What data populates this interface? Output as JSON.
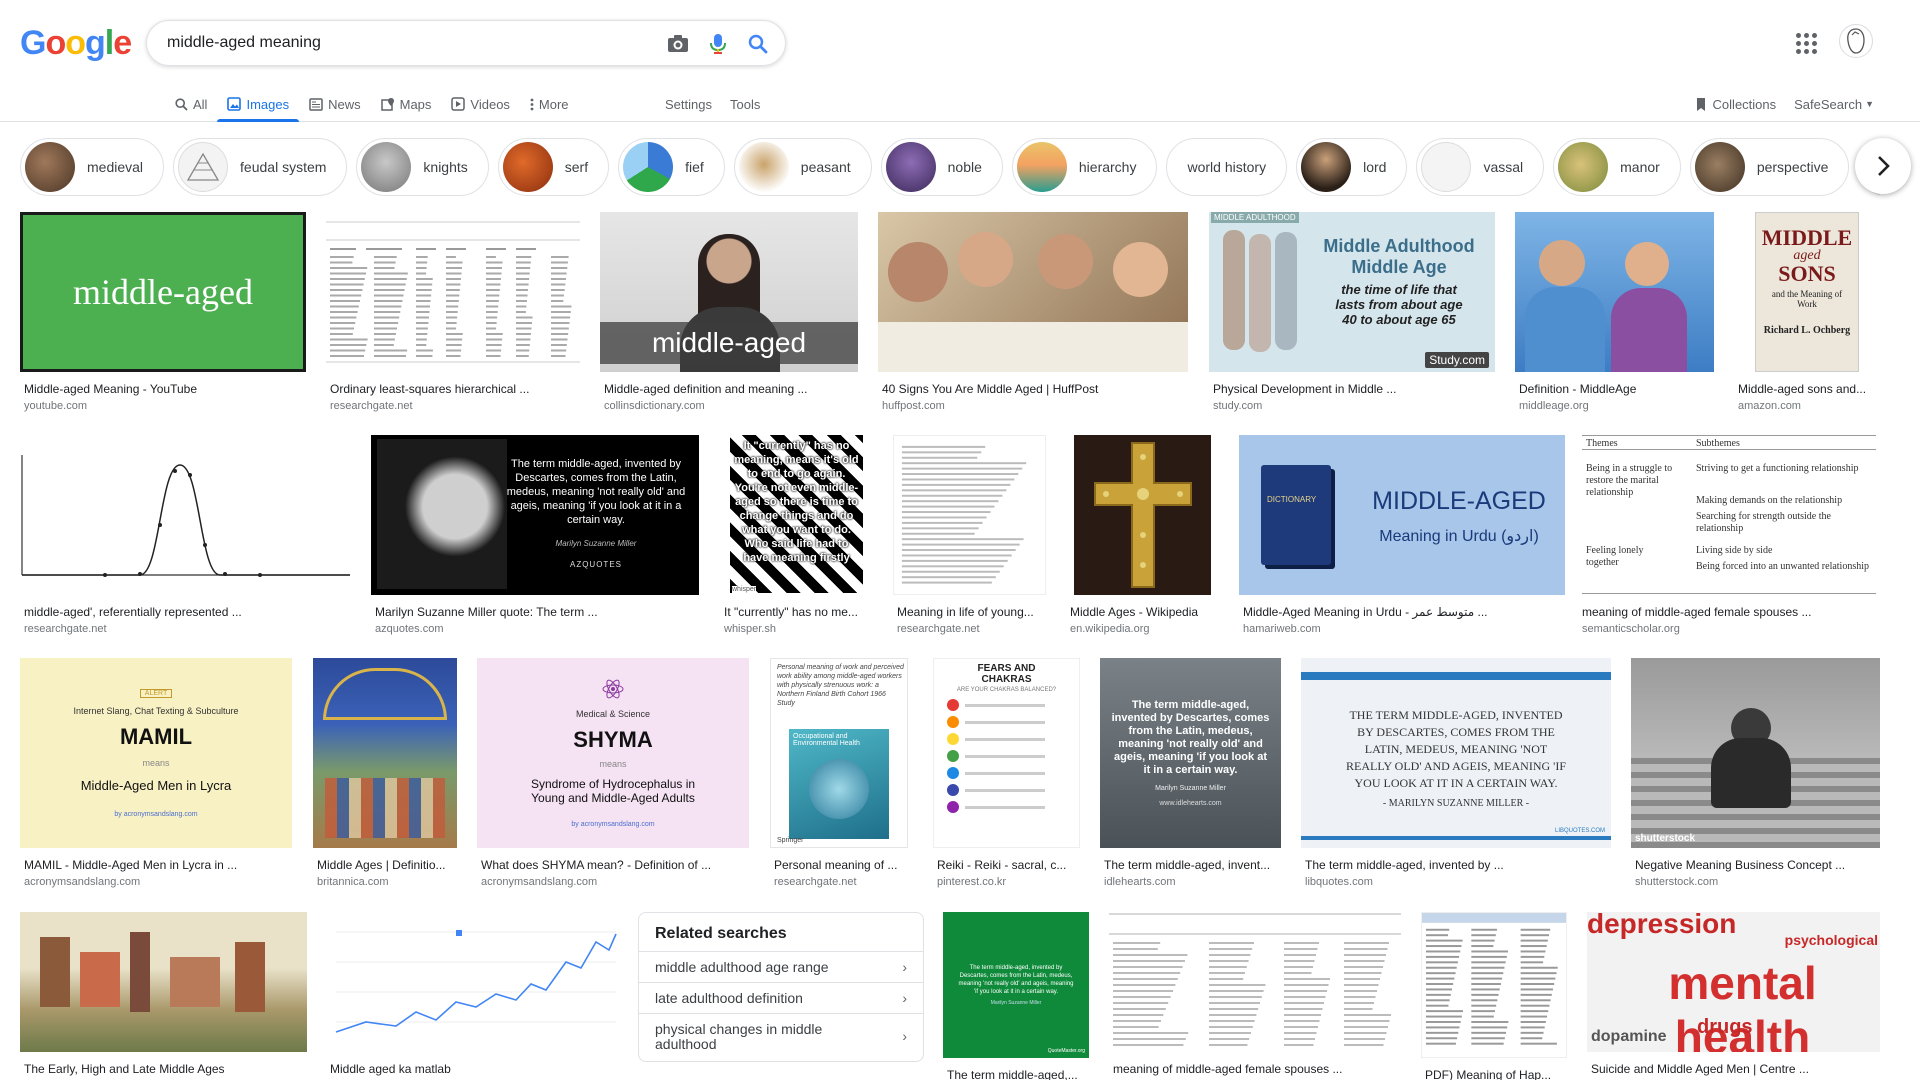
{
  "logo": "Google",
  "colors": {
    "blue": "#4285f4",
    "red": "#ea4335",
    "yellow": "#fbbc05",
    "green": "#34a853",
    "accent": "#1a73e8"
  },
  "search": {
    "query": "middle-aged meaning"
  },
  "tabs": [
    {
      "label": "All",
      "icon": "search-icon"
    },
    {
      "label": "Images",
      "icon": "image-icon"
    },
    {
      "label": "News",
      "icon": "news-icon"
    },
    {
      "label": "Maps",
      "icon": "map-icon"
    },
    {
      "label": "Videos",
      "icon": "video-icon"
    },
    {
      "label": "More",
      "icon": "more-vert-icon"
    }
  ],
  "tools": {
    "settings": "Settings",
    "tools": "Tools"
  },
  "right": {
    "collections": "Collections",
    "safesearch": "SafeSearch"
  },
  "chips": [
    "medieval",
    "feudal system",
    "knights",
    "serf",
    "fief",
    "peasant",
    "noble",
    "hierarchy",
    "world history",
    "lord",
    "vassal",
    "manor",
    "perspective"
  ],
  "results": [
    {
      "caption": "Middle-aged Meaning - YouTube",
      "source": "youtube.com",
      "text": "middle-aged"
    },
    {
      "caption": "Ordinary least-squares hierarchical ...",
      "source": "researchgate.net"
    },
    {
      "caption": "Middle-aged definition and meaning ...",
      "source": "collinsdictionary.com",
      "text": "middle-aged"
    },
    {
      "caption": "40 Signs You Are Middle Aged | HuffPost",
      "source": "huffpost.com"
    },
    {
      "caption": "Physical Development in Middle ...",
      "source": "study.com",
      "text": "Middle Adulthood",
      "text2": "Middle Age",
      "text3": "the time of life that lasts from about age 40 to about age 65",
      "text4": "Study.com",
      "text5": "MIDDLE ADULTHOOD"
    },
    {
      "caption": "Definition - MiddleAge",
      "source": "middleage.org"
    },
    {
      "caption": "Middle-aged sons and...",
      "source": "amazon.com",
      "text": "MIDDLE",
      "text2": "aged",
      "text3": "SONS",
      "text4": "and the Meaning of Work",
      "text5": "Richard L. Ochberg"
    },
    {
      "caption": "middle-aged', referentially represented ...",
      "source": "researchgate.net"
    },
    {
      "caption": "Marilyn Suzanne Miller quote: The term ...",
      "source": "azquotes.com",
      "text": "The term middle-aged, invented by Descartes, comes from the Latin, medeus, meaning 'not really old' and ageis, meaning 'if you look at it in a certain way.",
      "text2": "Marilyn Suzanne Miller",
      "text3": "AZQUOTES"
    },
    {
      "caption": "It \"currently\" has no me...",
      "source": "whisper.sh",
      "text": "It \"currently\" has no meaning, means it's old to end to go again. You're not even middle-aged so there is time to change things and do what you want to do. Who said life had to have meaning firstly",
      "text2": "whisper"
    },
    {
      "caption": "Meaning in life of young...",
      "source": "researchgate.net"
    },
    {
      "caption": "Middle Ages - Wikipedia",
      "source": "en.wikipedia.org"
    },
    {
      "caption": "Middle-Aged Meaning in Urdu - متوسط عمر ...",
      "source": "hamariweb.com",
      "text": "MIDDLE-AGED",
      "text2": "Meaning in Urdu (اردو)",
      "text3": "DICTIONARY"
    },
    {
      "caption": "meaning of middle-aged female spouses ...",
      "source": "semanticscholar.org",
      "text": "Themes",
      "text2": "Subthemes",
      "text3": "Being in a struggle to restore the marital relationship",
      "text4": "Striving to get a functioning relationship",
      "text5": "Making demands on the relationship",
      "text6": "Searching for strength outside the relationship",
      "text7": "Feeling lonely together",
      "text8": "Living side by side",
      "text9": "Being forced into an unwanted relationship"
    },
    {
      "caption": "MAMIL - Middle-Aged Men in Lycra in ...",
      "source": "acronymsandslang.com",
      "text": "Internet Slang, Chat Texting & Subculture",
      "text2": "MAMIL",
      "text3": "means",
      "text4": "Middle-Aged Men in Lycra",
      "text5": "ALERT",
      "text6": "by acronymsandslang.com"
    },
    {
      "caption": "Middle Ages | Definitio...",
      "source": "britannica.com"
    },
    {
      "caption": "What does SHYMA mean? - Definition of ...",
      "source": "acronymsandslang.com",
      "text": "Medical & Science",
      "text2": "SHYMA",
      "text3": "means",
      "text4": "Syndrome of Hydrocephalus in Young and Middle-Aged Adults",
      "text5": "by acronymsandslang.com"
    },
    {
      "caption": "Personal meaning of ...",
      "source": "researchgate.net",
      "text": "Personal meaning of work and perceived work ability among middle-aged workers with physically strenuous work: a Northern Finland Birth Cohort 1966 Study",
      "text2": "Occupational and Environmental Health",
      "text3": "Springer"
    },
    {
      "caption": "Reiki - Reiki - sacral, c...",
      "source": "pinterest.co.kr",
      "text": "FEARS AND CHAKRAS",
      "text2": "ARE YOUR CHAKRAS BALANCED?"
    },
    {
      "caption": "The term middle-aged, invent...",
      "source": "idlehearts.com",
      "text": "The term middle-aged, invented by Descartes, comes from the Latin, medeus, meaning 'not really old' and ageis, meaning 'if you look at it in a certain way.",
      "text2": "Marilyn Suzanne Miller",
      "text3": "www.idlehearts.com"
    },
    {
      "caption": "The term middle-aged, invented by ...",
      "source": "libquotes.com",
      "text": "THE TERM MIDDLE-AGED, INVENTED BY DESCARTES, COMES FROM THE LATIN, MEDEUS, MEANING 'NOT REALLY OLD' AND AGEIS, MEANING 'IF YOU LOOK AT IT IN A CERTAIN WAY.",
      "text2": "- MARILYN SUZANNE MILLER -",
      "text3": "LIBQUOTES.COM"
    },
    {
      "caption": "Negative Meaning Business Concept ...",
      "source": "shutterstock.com",
      "text": "shutterstock"
    },
    {
      "caption": "The Early, High and Late Middle Ages",
      "source": ""
    },
    {
      "caption": "Middle aged ka matlab",
      "source": ""
    },
    {
      "caption": "The term middle-aged,...",
      "source": "",
      "text": "The term middle-aged, invented by Descartes, comes from the Latin, medeus, meaning 'not really old' and ageis, meaning 'if you look at it in a certain way.",
      "text2": "Marilyn Suzanne Miller",
      "text3": "QuoteMaster.org"
    },
    {
      "caption": "meaning of middle-aged female spouses ...",
      "source": ""
    },
    {
      "caption": "PDF) Meaning of Hap...",
      "source": ""
    },
    {
      "caption": "Suicide and Middle Aged Men | Centre ...",
      "source": "",
      "text": "depression",
      "text2": "mental health",
      "text3": "psychological",
      "text4": "drugs",
      "text5": "dopamine"
    }
  ],
  "related": {
    "title": "Related searches",
    "items": [
      "middle adulthood age range",
      "late adulthood definition",
      "physical changes in middle adulthood"
    ]
  }
}
